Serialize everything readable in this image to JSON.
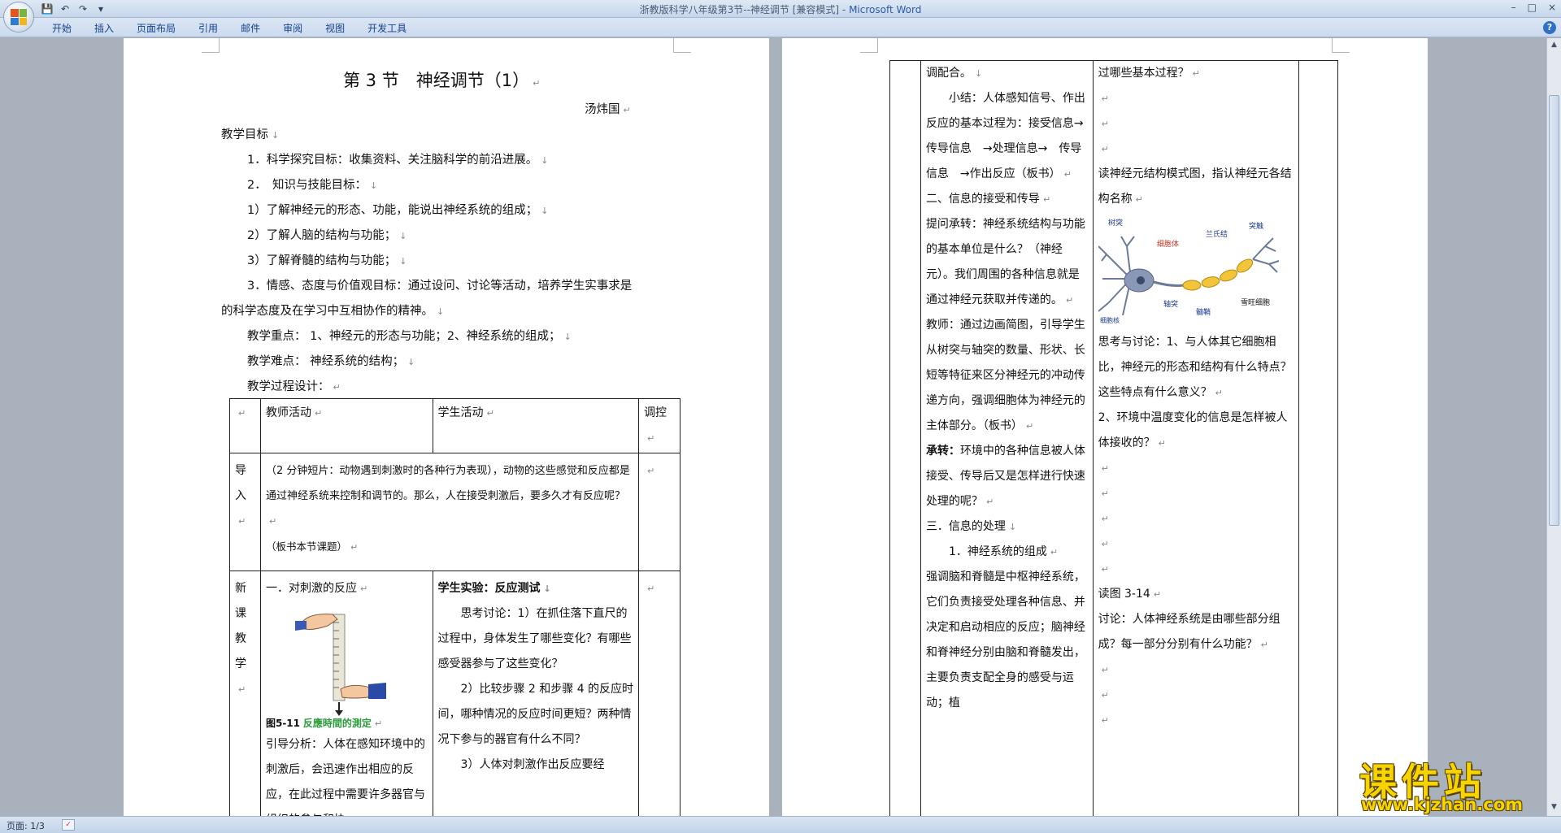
{
  "window": {
    "title": "浙教版科学八年级第3节--神经调节 [兼容模式] - ",
    "app_name": "Microsoft Word",
    "controls": [
      "–",
      "□",
      "×"
    ]
  },
  "ribbon": {
    "tabs": [
      "开始",
      "插入",
      "页面布局",
      "引用",
      "邮件",
      "审阅",
      "视图",
      "开发工具"
    ],
    "help": "?"
  },
  "page1": {
    "title": "第 3 节　神经调节（1）",
    "author": "汤炜国",
    "lines": [
      "教学目标",
      "1．科学探究目标：收集资料、关注脑科学的前沿进展。",
      "2．　知识与技能目标：",
      "1）了解神经元的形态、功能，能说出神经系统的组成；",
      "2）了解人脑的结构与功能；",
      "3）了解脊髓的结构与功能；",
      "3．情感、态度与价值观目标：通过设问、讨论等活动，培养学生实事求是",
      "的科学态度及在学习中互相协作的精神。",
      "教学重点：  1、神经元的形态与功能；2、神经系统的组成；",
      "教学难点：  神经系统的结构；",
      "教学过程设计："
    ],
    "table": {
      "headers": [
        "教师活动",
        "学生活动",
        "调控"
      ],
      "row1": {
        "label": "导入",
        "teacher": "（2 分钟短片：动物遇到刺激时的各种行为表现），动物的这些感觉和反应都是通过神经系统来控制和调节的。那么，人在接受刺激后，要多久才有反应呢？",
        "teacher_note": "（板书本节课题）"
      },
      "row2": {
        "label": "新课教学",
        "teacher_heading": "一．对刺激的反应",
        "figure_caption_num": "图5-11",
        "figure_caption": "反應時間的測定",
        "teacher_text": "引导分析：人体在感知环境中的刺激后，会迅速作出相应的反应，在此过程中需要许多器官与组织的参与和协",
        "student_heading": "学生实验：反应测试",
        "student_p1": "思考讨论：1）在抓住落下直尺的过程中，身体发生了哪些变化？有哪些感受器参与了这些变化？",
        "student_p2": "2）比较步骤 2 和步骤 4 的反应时间，哪种情况的反应时间更短？两种情况下参与的器官有什么不同？",
        "student_p3": "3）人体对刺激作出反应要经"
      }
    }
  },
  "page2": {
    "teacher_col": [
      "调配合。",
      "小结：人体感知信号、作出反应的基本过程为：接受信息→　传导信息　→处理信息→　传导信息　→作出反应（板书）",
      "二、信息的接受和传导",
      "提问承转：神经系统结构与功能的基本单位是什么？（神经元）。我们周围的各种信息就是通过神经元获取并传递的。",
      "教师：通过边画简图，引导学生从树突与轴突的数量、形状、长短等特征来区分神经元的冲动传递方向，强调细胞体为神经元的主体部分。（板书）",
      "承转：",
      "环境中的各种信息被人体接受、传导后又是怎样进行快速处理的呢？",
      "三．信息的处理",
      "1．神经系统的组成",
      "强调脑和脊髓是中枢神经系统，它们负责接受处理各种信息、并决定和启动相应的反应；脑神经和脊神经分别由脑和脊髓发出，主要负责支配全身的感受与运动；植"
    ],
    "student_col": [
      "过哪些基本过程？",
      "读神经元结构模式图，指认神经元各结构名称",
      "思考与讨论：1、与人体其它细胞相比，神经元的形态和结构有什么特点？这些特点有什么意义？",
      "2、环境中温度变化的信息是怎样被人体接收的？",
      "读图 3-14",
      "讨论：人体神经系统是由哪些部分组成？每一部分分别有什么功能？"
    ],
    "neuron_labels": [
      "树突",
      "细胞体",
      "兰氏结",
      "突触",
      "轴突",
      "髓鞘",
      "雪旺细胞",
      "细胞核"
    ]
  },
  "status": {
    "pages": "页面: 1/3"
  },
  "watermark": {
    "title": "课件站",
    "url": "www.kjzhan.com"
  },
  "colors": {
    "ribbon_text": "#15428b",
    "caption_green": "#2a9a3a",
    "watermark_yellow": "#f7d400"
  }
}
